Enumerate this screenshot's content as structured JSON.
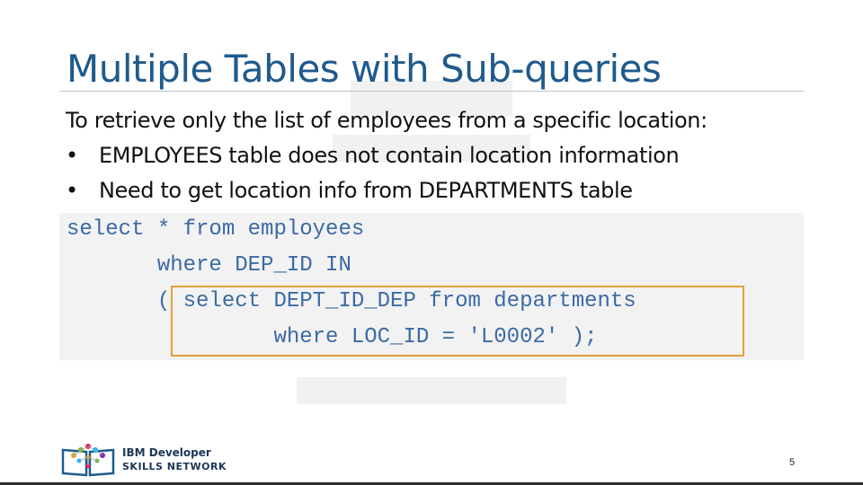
{
  "slide": {
    "title": "Multiple Tables with Sub-queries",
    "intro": "To retrieve only the list of employees from a specific location:",
    "bullets": [
      "EMPLOYEES table does not contain location information",
      "Need to get location info from DEPARTMENTS table"
    ],
    "bullet_symbol": "•",
    "code_lines": [
      "select * from employees",
      "       where DEP_ID IN",
      "       ( select DEPT_ID_DEP from departments",
      "                where LOC_ID = 'L0002' );"
    ],
    "page_number": "5"
  },
  "footer": {
    "logo_icon": "book-network-icon",
    "logo_line1": "IBM Developer",
    "logo_line2": "SKILLS NETWORK"
  },
  "colors": {
    "title": "#1f5a8c",
    "code_text": "#3b6aa5",
    "code_background": "#f2f2f2",
    "highlight_border": "#e0a236"
  }
}
